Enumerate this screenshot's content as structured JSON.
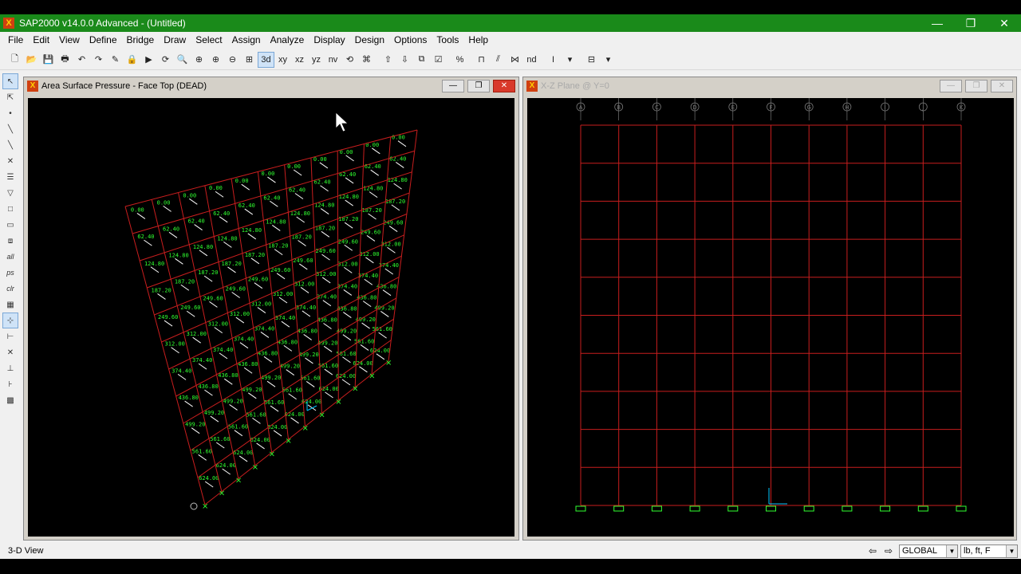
{
  "app": {
    "title": "SAP2000 v14.0.0 Advanced  - (Untitled)",
    "icon_glyph": "X"
  },
  "window_controls": {
    "minimize": "—",
    "restore": "❐",
    "close": "✕"
  },
  "menu": [
    "File",
    "Edit",
    "View",
    "Define",
    "Bridge",
    "Draw",
    "Select",
    "Assign",
    "Analyze",
    "Display",
    "Design",
    "Options",
    "Tools",
    "Help"
  ],
  "toolbar": {
    "view_3d_label": "3d",
    "view_xy_label": "xy",
    "view_xz_label": "xz",
    "view_yz_label": "yz",
    "view_nv_label": "nv",
    "nd_label": "nd"
  },
  "left_tools": {
    "all_label": "all",
    "ps_label": "ps",
    "clr_label": "clr"
  },
  "left_pane": {
    "title": "Area Surface Pressure - Face Top (DEAD)",
    "pressure_labels": [
      "0.00",
      "62.40",
      "124.80",
      "187.20",
      "249.60",
      "312.00",
      "374.40",
      "436.80",
      "499.20",
      "561.60",
      "624.00"
    ]
  },
  "right_pane": {
    "title": "X-Z Plane @ Y=0",
    "grid_bubbles": [
      "A",
      "B",
      "C",
      "D",
      "E",
      "F",
      "G",
      "H",
      "I",
      "J",
      "K"
    ]
  },
  "status": {
    "text": "3-D View",
    "coord_system": "GLOBAL",
    "units": "lb, ft, F"
  },
  "colors": {
    "frame": "#c81e1e",
    "load": "#30ff30",
    "arrow": "#ffffff",
    "axis": "#00c8ff",
    "titlebar": "#1a8a1a"
  }
}
